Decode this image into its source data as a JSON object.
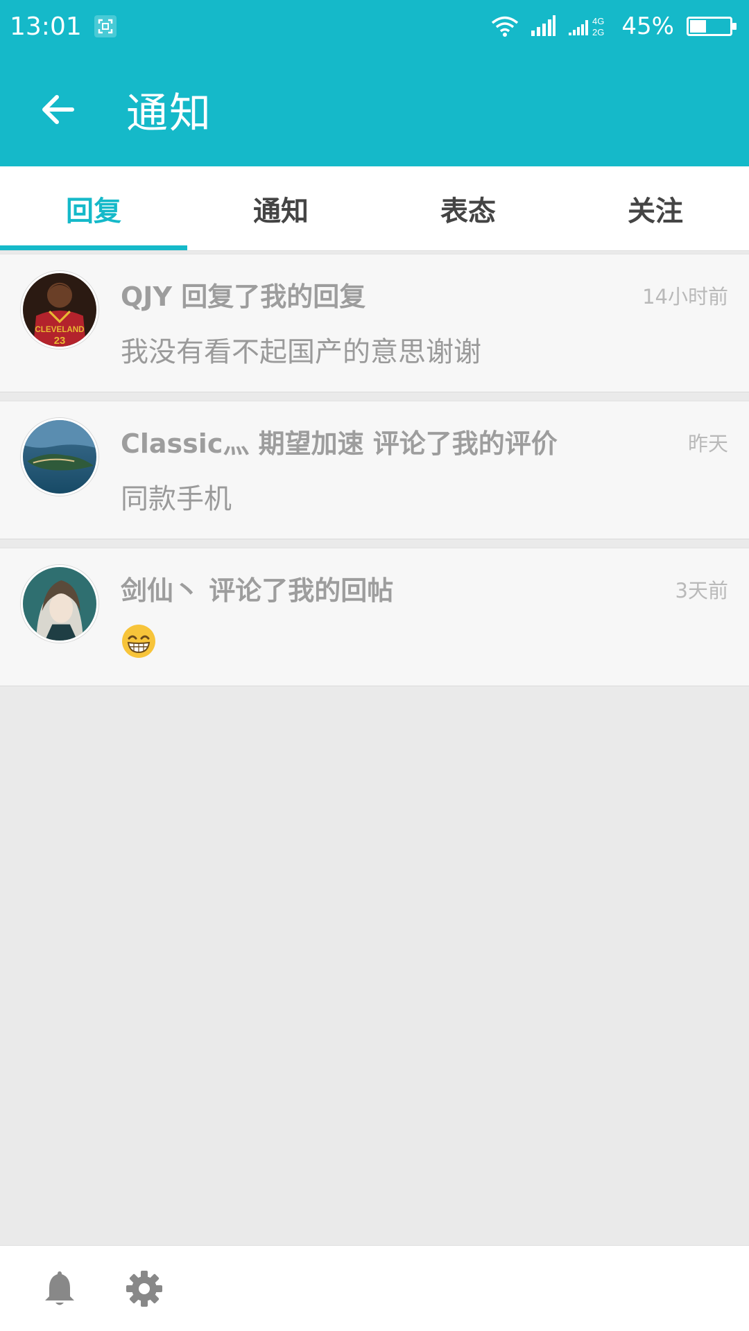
{
  "status_bar": {
    "time": "13:01",
    "battery_text": "45%",
    "battery_level": 0.45,
    "icons": [
      "screenshot-icon",
      "wifi-icon",
      "signal-icon",
      "signal-4g-2g-icon",
      "battery-icon"
    ]
  },
  "toolbar": {
    "back_icon": "arrow-left-icon",
    "title": "通知"
  },
  "tabs": [
    {
      "label": "回复",
      "active": true
    },
    {
      "label": "通知",
      "active": false
    },
    {
      "label": "表态",
      "active": false
    },
    {
      "label": "关注",
      "active": false
    }
  ],
  "notifications": [
    {
      "avatar": "avatar-basketball-player",
      "title": "QJY 回复了我的回复",
      "time": "14小时前",
      "content": "我没有看不起国产的意思谢谢"
    },
    {
      "avatar": "avatar-island-landscape",
      "title": "Classic灬 期望加速 评论了我的评价",
      "time": "昨天",
      "content": "同款手机"
    },
    {
      "avatar": "avatar-anime-character",
      "title": "剑仙丶 评论了我的回帖",
      "time": "3天前",
      "content_icon": "grinning-emoji-icon"
    }
  ],
  "bottom_bar": {
    "icons": [
      "bell-icon",
      "gear-icon"
    ]
  },
  "colors": {
    "accent": "#15b9c9",
    "item_bg": "#f7f7f7",
    "page_bg": "#eaeaea"
  }
}
